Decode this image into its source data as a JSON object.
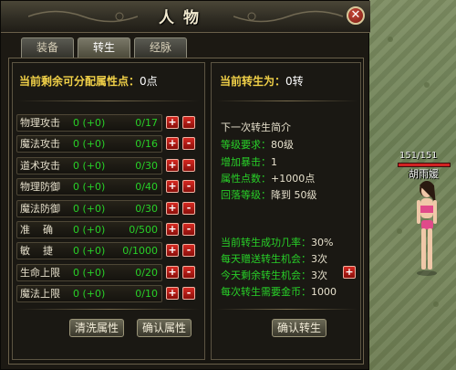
{
  "window": {
    "title": "人物"
  },
  "tabs": [
    {
      "label": "装备",
      "active": false
    },
    {
      "label": "转生",
      "active": true
    },
    {
      "label": "经脉",
      "active": false
    }
  ],
  "left": {
    "points_label": "当前剩余可分配属性点：",
    "points_value": "0点",
    "attributes": [
      {
        "name": "物理攻击",
        "value": "0 (+0)",
        "cap": "0/17"
      },
      {
        "name": "魔法攻击",
        "value": "0 (+0)",
        "cap": "0/16"
      },
      {
        "name": "道术攻击",
        "value": "0 (+0)",
        "cap": "0/30"
      },
      {
        "name": "物理防御",
        "value": "0 (+0)",
        "cap": "0/40"
      },
      {
        "name": "魔法防御",
        "value": "0 (+0)",
        "cap": "0/30"
      },
      {
        "name": "准    确",
        "value": "0 (+0)",
        "cap": "0/500"
      },
      {
        "name": "敏    捷",
        "value": "0 (+0)",
        "cap": "0/1000"
      },
      {
        "name": "生命上限",
        "value": "0 (+0)",
        "cap": "0/20"
      },
      {
        "name": "魔法上限",
        "value": "0 (+0)",
        "cap": "0/10"
      }
    ],
    "plus": "+",
    "minus": "-",
    "reset_button": "清洗属性",
    "confirm_button": "确认属性"
  },
  "right": {
    "rebirth_label": "当前转生为：",
    "rebirth_value": "0转",
    "intro_title": "下一次转生简介",
    "level_req_key": "等级要求：",
    "level_req_val": "80级",
    "crit_key": "增加暴击：",
    "crit_val": "1",
    "attr_points_key": "属性点数：",
    "attr_points_val": "+1000点",
    "fallback_key": "回落等级：",
    "fallback_val": "降到 50级",
    "success_key": "当前转生成功几率：",
    "success_val": "30%",
    "daily_gift_key": "每天赠送转生机会：",
    "daily_gift_val": "3次",
    "remaining_key": "今天剩余转生机会：",
    "remaining_val": "3次",
    "gold_key": "每次转生需要金币：",
    "gold_val": "1000",
    "plus": "+",
    "confirm_button": "确认转生"
  },
  "scene": {
    "hp_text": "151/151",
    "player_name": "胡雨媛",
    "hp_fraction": 1.0
  }
}
